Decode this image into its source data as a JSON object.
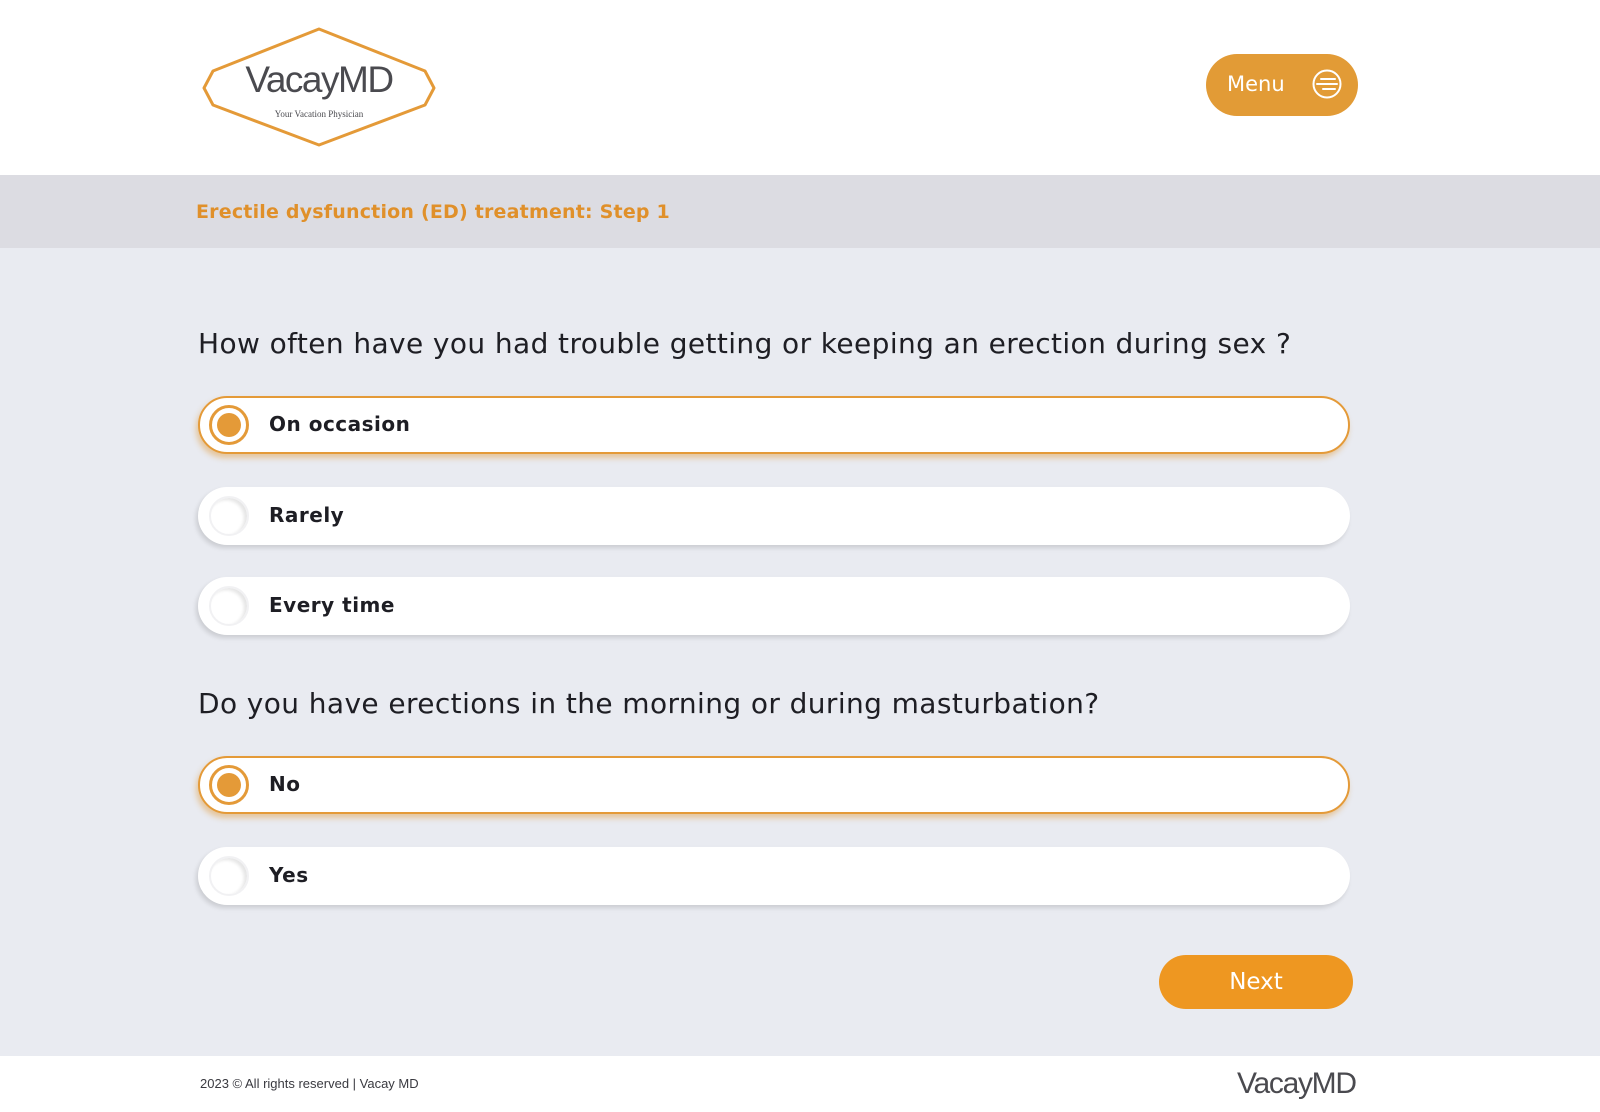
{
  "header": {
    "logo": {
      "name": "VacayMD",
      "tagline": "Your Vacation Physician"
    },
    "menu": {
      "label": "Menu",
      "icon": "menu-lines-icon"
    }
  },
  "step": {
    "title": "Erectile dysfunction (ED) treatment: Step 1"
  },
  "questions": [
    {
      "text": "How often have you had trouble getting or keeping an erection during sex ?",
      "selected": "On occasion",
      "options": [
        {
          "label": "On occasion",
          "selected": true
        },
        {
          "label": "Rarely",
          "selected": false
        },
        {
          "label": "Every time",
          "selected": false
        }
      ]
    },
    {
      "text": "Do you have erections in the morning or during masturbation?",
      "selected": "No",
      "options": [
        {
          "label": "No",
          "selected": true
        },
        {
          "label": "Yes",
          "selected": false
        }
      ]
    }
  ],
  "actions": {
    "next_label": "Next"
  },
  "footer": {
    "copyright": "2023 © All rights reserved | Vacay MD",
    "logo": "VacayMD"
  },
  "colors": {
    "accent": "#e49a38",
    "next_button": "#ee9721",
    "step_title": "#e0902a",
    "step_bar": "#dcdce2",
    "main_background": "#e9ebf1"
  }
}
